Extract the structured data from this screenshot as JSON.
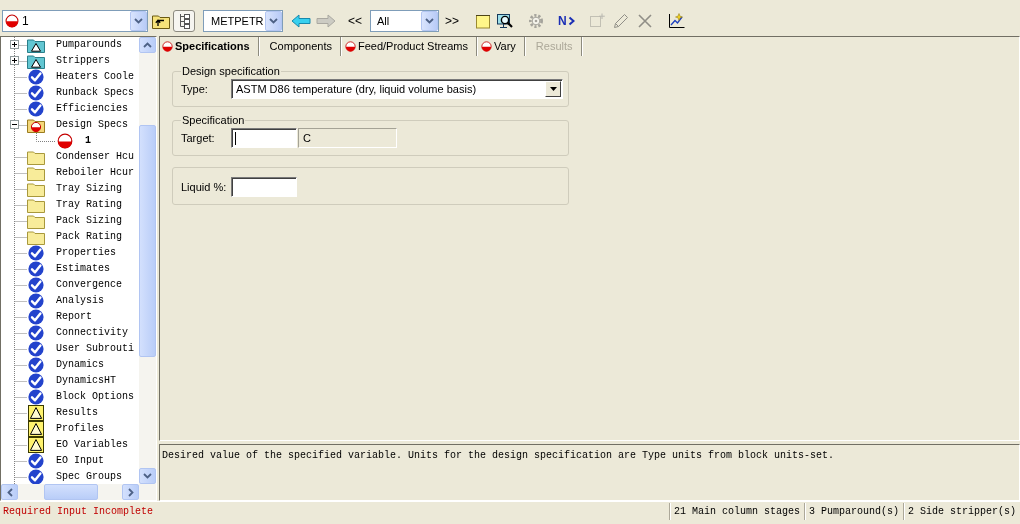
{
  "toolbar": {
    "block_selector": {
      "value": "1",
      "incomplete": true
    },
    "tree_toggle": {
      "pressed": true
    },
    "units_selector": {
      "value": "METPETR"
    },
    "back": {
      "disabled": false
    },
    "forward": {
      "disabled": true
    },
    "previous_label": "<<",
    "filter_selector": {
      "value": "All"
    },
    "next_label": ">>",
    "tools": [
      {
        "disabled": false
      },
      {
        "disabled": false
      },
      {
        "disabled": true
      },
      {
        "disabled": false,
        "label": "N"
      },
      {
        "disabled": true
      },
      {
        "disabled": true
      },
      {
        "disabled": true
      },
      {
        "disabled": false
      }
    ]
  },
  "tree": {
    "items": [
      {
        "label": "Pumparounds",
        "folder": true,
        "kind": "warning",
        "expanded": false,
        "selected": false
      },
      {
        "label": "Strippers",
        "folder": true,
        "kind": "warning",
        "expanded": false,
        "selected": false
      },
      {
        "label": "Heaters Coole",
        "folder": false,
        "kind": "complete",
        "selected": false
      },
      {
        "label": "Runback Specs",
        "folder": false,
        "kind": "complete",
        "selected": false
      },
      {
        "label": "Efficiencies",
        "folder": false,
        "kind": "complete",
        "selected": false
      },
      {
        "label": "Design Specs",
        "folder": true,
        "kind": "required",
        "expanded": true,
        "selected": false,
        "children": [
          {
            "label": "1",
            "folder": false,
            "kind": "required",
            "selected": true
          }
        ]
      },
      {
        "label": "Condenser Hcu",
        "folder": true,
        "kind": "empty",
        "selected": false
      },
      {
        "label": "Reboiler Hcur",
        "folder": true,
        "kind": "empty",
        "selected": false
      },
      {
        "label": "Tray Sizing",
        "folder": true,
        "kind": "empty",
        "selected": false
      },
      {
        "label": "Tray Rating",
        "folder": true,
        "kind": "empty",
        "selected": false
      },
      {
        "label": "Pack Sizing",
        "folder": true,
        "kind": "empty",
        "selected": false
      },
      {
        "label": "Pack Rating",
        "folder": true,
        "kind": "empty",
        "selected": false
      },
      {
        "label": "Properties",
        "folder": false,
        "kind": "complete",
        "selected": false
      },
      {
        "label": "Estimates",
        "folder": false,
        "kind": "complete",
        "selected": false
      },
      {
        "label": "Convergence",
        "folder": false,
        "kind": "complete",
        "selected": false
      },
      {
        "label": "Analysis",
        "folder": false,
        "kind": "complete",
        "selected": false
      },
      {
        "label": "Report",
        "folder": false,
        "kind": "complete",
        "selected": false
      },
      {
        "label": "Connectivity",
        "folder": false,
        "kind": "complete",
        "selected": false
      },
      {
        "label": "User Subrouti",
        "folder": false,
        "kind": "complete",
        "selected": false
      },
      {
        "label": "Dynamics",
        "folder": false,
        "kind": "complete",
        "selected": false
      },
      {
        "label": "DynamicsHT",
        "folder": false,
        "kind": "complete",
        "selected": false
      },
      {
        "label": "Block Options",
        "folder": false,
        "kind": "complete",
        "selected": false
      },
      {
        "label": "Results",
        "folder": false,
        "kind": "warning",
        "selected": false
      },
      {
        "label": "Profiles",
        "folder": false,
        "kind": "warning",
        "selected": false
      },
      {
        "label": "EO Variables",
        "folder": false,
        "kind": "warning",
        "selected": false
      },
      {
        "label": "EO Input",
        "folder": false,
        "kind": "complete",
        "selected": false
      },
      {
        "label": "Spec Groups",
        "folder": false,
        "kind": "complete",
        "selected": false
      }
    ]
  },
  "tabs": [
    {
      "label": "Specifications",
      "selected": true,
      "incomplete": true,
      "disabled": false
    },
    {
      "label": "Components",
      "selected": false,
      "incomplete": false,
      "disabled": false
    },
    {
      "label": "Feed/Product Streams",
      "selected": false,
      "incomplete": true,
      "disabled": false
    },
    {
      "label": "Vary",
      "selected": false,
      "incomplete": true,
      "disabled": false
    },
    {
      "label": "Results",
      "selected": false,
      "incomplete": false,
      "disabled": true
    }
  ],
  "form": {
    "groups": [
      {
        "title": "Design specification",
        "fields": [
          {
            "label": "Type:",
            "kind": "select",
            "value": "ASTM D86 temperature (dry, liquid volume basis)"
          }
        ]
      },
      {
        "title": "Specification",
        "fields": [
          {
            "label": "Target:",
            "kind": "input",
            "focused": true,
            "unit": "C"
          }
        ]
      },
      {
        "fields": [
          {
            "label": "Liquid %:",
            "kind": "input",
            "focused": false
          }
        ]
      }
    ]
  },
  "prompt": "Desired value of the specified variable. Units for the design specification are Type units from block units-set.",
  "status_bar": {
    "message": "Required Input Incomplete",
    "panes": [
      "21 Main column stages",
      "3 Pumparound(s)",
      "2 Side stripper(s)"
    ]
  }
}
